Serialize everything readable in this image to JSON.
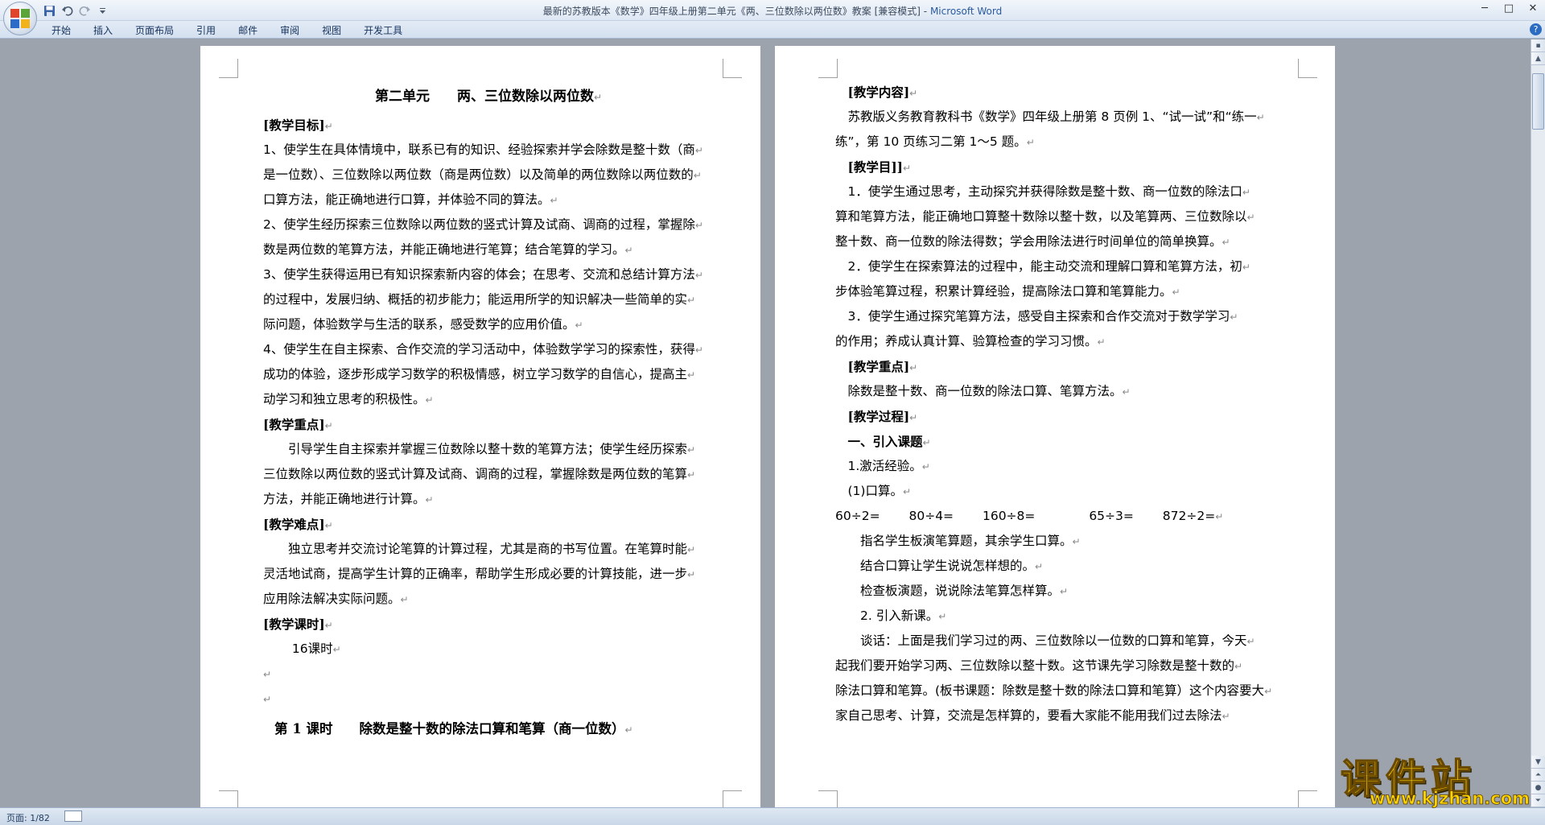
{
  "window": {
    "title_doc": "最新的苏教版本《数学》四年级上册第二单元《两、三位数除以两位数》教案 [兼容模式]",
    "title_sep": " - ",
    "title_app": "Microsoft Word",
    "minimize": "─",
    "maximize": "□",
    "close": "✕"
  },
  "ribbon": {
    "tabs": [
      "开始",
      "插入",
      "页面布局",
      "引用",
      "邮件",
      "审阅",
      "视图",
      "开发工具"
    ],
    "help": "?"
  },
  "page1": {
    "lines": [
      {
        "text": "第二单元　　两、三位数除以两位数",
        "style": "title"
      },
      {
        "text": "[教学目标]",
        "style": "bracket"
      },
      {
        "text": "1、使学生在具体情境中，联系已有的知识、经验探索并学会除数是整十数（商",
        "style": "body"
      },
      {
        "text": "是一位数）、三位数除以两位数（商是两位数）以及简单的两位数除以两位数的",
        "style": "body"
      },
      {
        "text": "口算方法，能正确地进行口算，并体验不同的算法。",
        "style": "body"
      },
      {
        "text": "2、使学生经历探索三位数除以两位数的竖式计算及试商、调商的过程，掌握除",
        "style": "body"
      },
      {
        "text": "数是两位数的笔算方法，并能正确地进行笔算；结合笔算的学习。",
        "style": "body"
      },
      {
        "text": "3、使学生获得运用已有知识探索新内容的体会；在思考、交流和总结计算方法",
        "style": "body"
      },
      {
        "text": "的过程中，发展归纳、概括的初步能力；能运用所学的知识解决一些简单的实",
        "style": "body"
      },
      {
        "text": "际问题，体验数学与生活的联系，感受数学的应用价值。",
        "style": "body"
      },
      {
        "text": "4、使学生在自主探索、合作交流的学习活动中，体验数学学习的探索性，获得",
        "style": "body"
      },
      {
        "text": "成功的体验，逐步形成学习数学的积极情感，树立学习数学的自信心，提高主",
        "style": "body"
      },
      {
        "text": "动学习和独立思考的积极性。",
        "style": "body"
      },
      {
        "text": "[教学重点]",
        "style": "bracket"
      },
      {
        "text": "　　引导学生自主探索并掌握三位数除以整十数的笔算方法；使学生经历探索",
        "style": "body"
      },
      {
        "text": "三位数除以两位数的竖式计算及试商、调商的过程，掌握除数是两位数的笔算",
        "style": "body"
      },
      {
        "text": "方法，并能正确地进行计算。",
        "style": "body"
      },
      {
        "text": "[教学难点]",
        "style": "bracket"
      },
      {
        "text": "　　独立思考并交流讨论笔算的计算过程，尤其是商的书写位置。在笔算时能",
        "style": "body"
      },
      {
        "text": "灵活地试商，提高学生计算的正确率，帮助学生形成必要的计算技能，进一步",
        "style": "body"
      },
      {
        "text": "应用除法解决实际问题。",
        "style": "body"
      },
      {
        "text": "[教学课时]",
        "style": "bracket"
      },
      {
        "text": "　　 16课时",
        "style": "body"
      },
      {
        "text": "",
        "style": "body"
      },
      {
        "text": "",
        "style": "body"
      },
      {
        "text": "第 1 课时　　除数是整十数的除法口算和笔算（商一位数）",
        "style": "heading2"
      }
    ]
  },
  "page2": {
    "lines": [
      {
        "text": "　[教学内容]",
        "style": "bracket"
      },
      {
        "text": "　苏教版义务教育教科书《数学》四年级上册第 8 页例 1、“试一试”和“练一",
        "style": "body"
      },
      {
        "text": "练”，第 10 页练习二第 1～5 题。",
        "style": "body"
      },
      {
        "text": "　[教学目]]",
        "style": "bracket"
      },
      {
        "text": "　1．使学生通过思考，主动探究并获得除数是整十数、商一位数的除法口",
        "style": "body"
      },
      {
        "text": "算和笔算方法，能正确地口算整十数除以整十数，以及笔算两、三位数除以",
        "style": "body"
      },
      {
        "text": "整十数、商一位数的除法得数；学会用除法进行时间单位的简单换算。",
        "style": "body"
      },
      {
        "text": "　2．使学生在探索算法的过程中，能主动交流和理解口算和笔算方法，初",
        "style": "body"
      },
      {
        "text": "步体验笔算过程，积累计算经验，提高除法口算和笔算能力。",
        "style": "body"
      },
      {
        "text": "　3．使学生通过探究笔算方法，感受自主探索和合作交流对于数学学习",
        "style": "body"
      },
      {
        "text": "的作用；养成认真计算、验算检查的学习习惯。",
        "style": "body"
      },
      {
        "text": "　[教学重点]",
        "style": "bracket"
      },
      {
        "text": "　除数是整十数、商一位数的除法口算、笔算方法。",
        "style": "body"
      },
      {
        "text": "　[教学过程]",
        "style": "bracket"
      },
      {
        "text": "　一、引入课题",
        "style": "bracket"
      },
      {
        "text": "　1.激活经验。",
        "style": "body"
      },
      {
        "text": "　(1)口算。",
        "style": "body"
      },
      {
        "text": "60÷2=　　 80÷4=　　 160÷8=　　　　 65÷3=　　 872÷2=",
        "style": "body"
      },
      {
        "text": "　　指名学生板演笔算题，其余学生口算。",
        "style": "body"
      },
      {
        "text": "　　结合口算让学生说说怎样想的。",
        "style": "body"
      },
      {
        "text": "　　检查板演题，说说除法笔算怎样算。",
        "style": "body"
      },
      {
        "text": "　　2. 引入新课。",
        "style": "body"
      },
      {
        "text": "　　谈话：上面是我们学习过的两、三位数除以一位数的口算和笔算，今天",
        "style": "body"
      },
      {
        "text": "起我们要开始学习两、三位数除以整十数。这节课先学习除数是整十数的",
        "style": "body"
      },
      {
        "text": "除法口算和笔算。(板书课题：除数是整十数的除法口算和笔算）这个内容要大",
        "style": "body"
      },
      {
        "text": "家自己思考、计算，交流是怎样算的，要看大家能不能用我们过去除法",
        "style": "body"
      }
    ]
  },
  "status": {
    "page_info": "页面: 1/82"
  },
  "watermark": {
    "text": "课件站",
    "url": "www.kjzhan.com"
  },
  "colors": {
    "office_red": "#e0442a",
    "office_green": "#5aa43a",
    "office_blue": "#2d6bc8",
    "office_yellow": "#f2b21b",
    "watermark_yellow": "#ffd400"
  }
}
